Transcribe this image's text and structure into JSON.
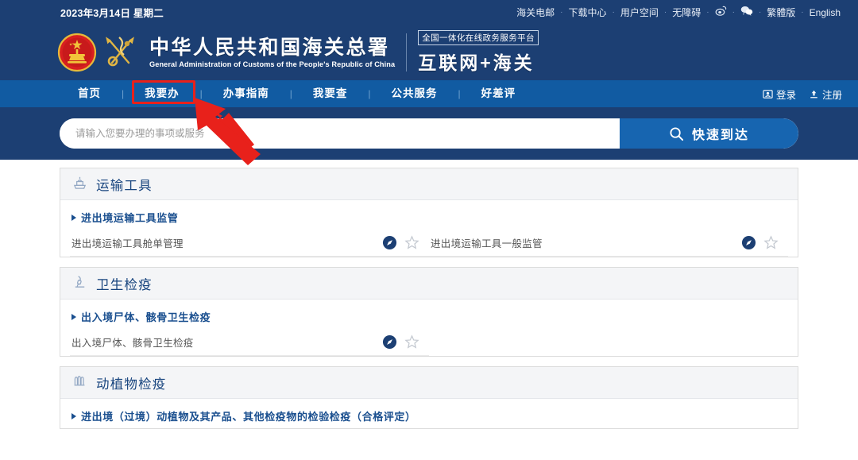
{
  "topbar": {
    "date": "2023年3月14日 星期二",
    "links": [
      {
        "label": "海关电邮",
        "type": "text"
      },
      {
        "label": "下载中心",
        "type": "text"
      },
      {
        "label": "用户空间",
        "type": "text"
      },
      {
        "label": "无障碍",
        "type": "text"
      },
      {
        "label": "weibo-icon",
        "type": "icon"
      },
      {
        "label": "wechat-icon",
        "type": "icon"
      },
      {
        "label": "繁體版",
        "type": "text"
      },
      {
        "label": "English",
        "type": "text"
      }
    ],
    "separator": "·"
  },
  "header": {
    "emblem_icon": "national-emblem-icon",
    "customs_icon": "customs-caduceus-key-icon",
    "title_cn": "中华人民共和国海关总署",
    "title_en": "General Administration of Customs of the People's Republic of China",
    "brand_tag": "全国一体化在线政务服务平台",
    "brand_main": "互联网+海关"
  },
  "nav": {
    "items": [
      {
        "label": "首页",
        "active": false
      },
      {
        "label": "我要办",
        "active": true
      },
      {
        "label": "办事指南",
        "active": false
      },
      {
        "label": "我要查",
        "active": false
      },
      {
        "label": "公共服务",
        "active": false
      },
      {
        "label": "好差评",
        "active": false
      }
    ],
    "separator": "|",
    "login_label": "登录",
    "register_label": "注册"
  },
  "search": {
    "placeholder": "请输入您要办理的事项或服务",
    "value": "",
    "button_label": "快速到达",
    "button_icon": "search-icon"
  },
  "annotation": {
    "highlight_target": "我要办",
    "box_color": "#e8211b",
    "arrow_color": "#e8211b"
  },
  "colors": {
    "header_bg": "#1c3f73",
    "nav_bg": "#115ba2",
    "search_btn": "#1765b0",
    "card_head_bg": "#f4f5f7",
    "title_blue": "#17447e",
    "subsec_blue": "#1a4f8f",
    "compass_blue": "#1c3f73"
  },
  "cards": [
    {
      "icon": "ship-transport-icon",
      "title": "运输工具",
      "sections": [
        {
          "title": "进出境运输工具监管",
          "items": [
            {
              "label": "进出境运输工具舱单管理",
              "nav_icon": "compass-icon",
              "fav_icon": "star-outline-icon"
            },
            {
              "label": "进出境运输工具一般监管",
              "nav_icon": "compass-icon",
              "fav_icon": "star-outline-icon"
            }
          ]
        }
      ]
    },
    {
      "icon": "microscope-icon",
      "title": "卫生检疫",
      "sections": [
        {
          "title": "出入境尸体、骸骨卫生检疫",
          "items": [
            {
              "label": "出入境尸体、骸骨卫生检疫",
              "nav_icon": "compass-icon",
              "fav_icon": "star-outline-icon"
            }
          ]
        }
      ]
    },
    {
      "icon": "plant-quarantine-icon",
      "title": "动植物检疫",
      "sections": [
        {
          "title": "进出境（过境）动植物及其产品、其他检疫物的检验检疫（合格评定）",
          "items": []
        }
      ]
    }
  ]
}
